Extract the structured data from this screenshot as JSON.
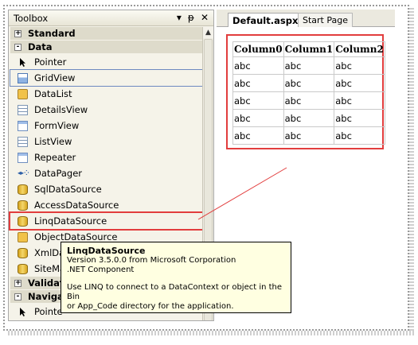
{
  "toolbox": {
    "title": "Toolbox",
    "title_icons": [
      "▾",
      "ᵽ",
      "✕"
    ],
    "groups": [
      {
        "label": "Standard",
        "expander": "+"
      },
      {
        "label": "Data",
        "expander": "-"
      },
      {
        "label": "Validati",
        "expander": "+"
      },
      {
        "label": "Naviga",
        "expander": "-"
      }
    ],
    "data_items": [
      {
        "label": "Pointer",
        "icon": "pointer-icon"
      },
      {
        "label": "GridView",
        "icon": "gridview-icon"
      },
      {
        "label": "DataList",
        "icon": "datalist-icon"
      },
      {
        "label": "DetailsView",
        "icon": "detailsview-icon"
      },
      {
        "label": "FormView",
        "icon": "formview-icon"
      },
      {
        "label": "ListView",
        "icon": "listview-icon"
      },
      {
        "label": "Repeater",
        "icon": "repeater-icon"
      },
      {
        "label": "DataPager",
        "icon": "datapager-icon"
      },
      {
        "label": "SqlDataSource",
        "icon": "sqldatasource-icon"
      },
      {
        "label": "AccessDataSource",
        "icon": "accessdatasource-icon"
      },
      {
        "label": "LinqDataSource",
        "icon": "linqdatasource-icon"
      },
      {
        "label": "ObjectDataSource",
        "icon": "objectdatasource-icon"
      },
      {
        "label": "XmlDat",
        "icon": "xmldatasource-icon"
      },
      {
        "label": "SiteMa",
        "icon": "sitemapdatasource-icon"
      }
    ],
    "nav_items": [
      {
        "label": "Pointe",
        "icon": "pointer-icon"
      }
    ],
    "pager_glyph": "◂▸⁘"
  },
  "designer": {
    "tabs": [
      {
        "label": "Default.aspx*"
      },
      {
        "label": "Start Page"
      }
    ],
    "grid": {
      "headers": [
        "Column0",
        "Column1",
        "Column2"
      ],
      "rows": [
        [
          "abc",
          "abc",
          "abc"
        ],
        [
          "abc",
          "abc",
          "abc"
        ],
        [
          "abc",
          "abc",
          "abc"
        ],
        [
          "abc",
          "abc",
          "abc"
        ],
        [
          "abc",
          "abc",
          "abc"
        ]
      ]
    }
  },
  "tooltip": {
    "title": "LinqDataSource",
    "line1": "Version 3.5.0.0 from Microsoft Corporation",
    "line2": ".NET Component",
    "line3": "Use LINQ to connect to a DataContext or object in the Bin",
    "line4": "or App_Code directory for the application."
  },
  "colors": {
    "highlight": "#e23d3d",
    "selection": "#6d89c0",
    "tooltip_bg": "#ffffe1"
  }
}
